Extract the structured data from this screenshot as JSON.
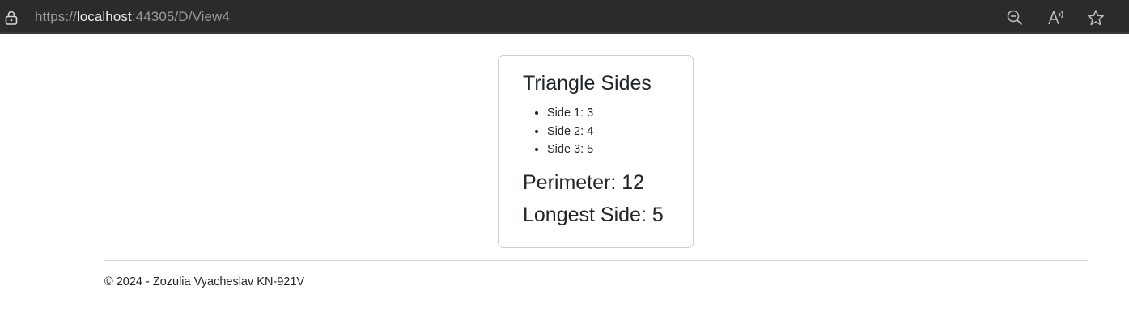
{
  "browser": {
    "url_scheme": "https://",
    "url_host": "localhost",
    "url_rest": ":44305/D/View4",
    "icons": [
      "lock-icon",
      "zoom-out-icon",
      "read-aloud-icon",
      "favorite-star-icon"
    ]
  },
  "card": {
    "title": "Triangle Sides",
    "sides": [
      "Side 1: 3",
      "Side 2: 4",
      "Side 3: 5"
    ],
    "perimeter": "Perimeter: 12",
    "longest": "Longest Side: 5"
  },
  "footer": {
    "text": "© 2024 - Zozulia Vyacheslav KN-921V"
  },
  "colors": {
    "browser_bar": "#2b2b2b",
    "url_muted": "#9a9a9a",
    "url_host": "#ececec",
    "text": "#212529",
    "card_border": "#cfcfcf"
  }
}
